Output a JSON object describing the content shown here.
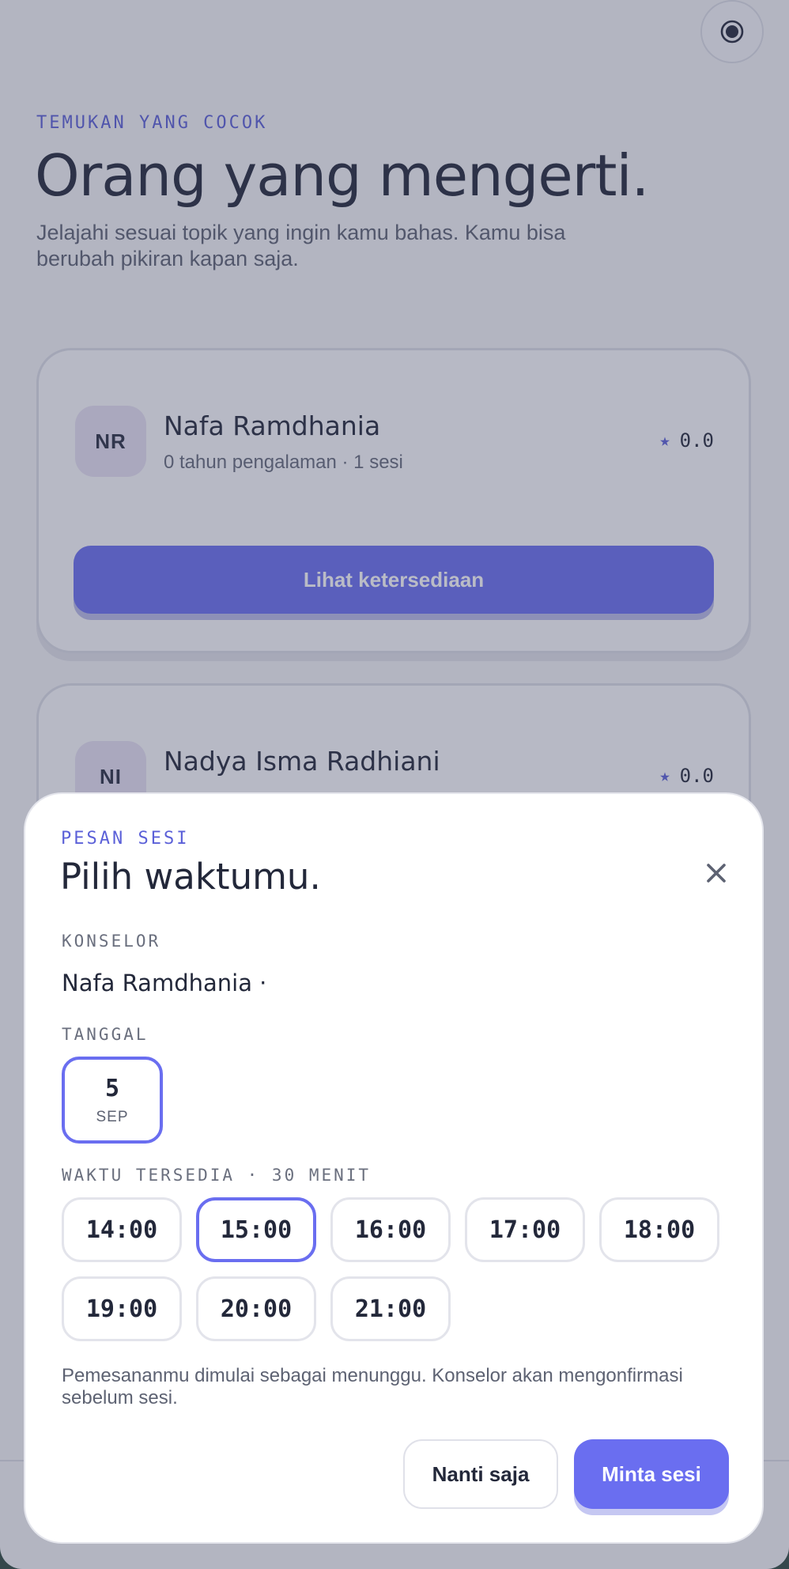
{
  "page": {
    "eyebrow": "TEMUKAN YANG COCOK",
    "title": "Orang yang mengerti.",
    "subtitle": "Jelajahi sesuai topik yang ingin kamu bahas. Kamu bisa berubah pikiran kapan saja."
  },
  "theme_toggle": {
    "icon": "radio-dot-icon"
  },
  "counselors": [
    {
      "initials": "NR",
      "name": "Nafa Ramdhania",
      "meta": "0 tahun pengalaman · 1 sesi",
      "rating_star": "★",
      "rating": "0.0",
      "action_label": "Lihat ketersediaan"
    },
    {
      "initials": "NI",
      "name": "Nadya Isma Radhiani",
      "rating_star": "★",
      "rating": "0.0"
    }
  ],
  "booking": {
    "eyebrow": "PESAN SESI",
    "title": "Pilih waktumu.",
    "close_icon": "close-icon",
    "counselor_label": "KONSELOR",
    "counselor_value": "Nafa Ramdhania ·",
    "date_label": "TANGGAL",
    "dates": [
      {
        "day": "5",
        "month": "SEP",
        "selected": true
      }
    ],
    "time_label": "WAKTU TERSEDIA · 30 MENIT",
    "slots": [
      "14:00",
      "15:00",
      "16:00",
      "17:00",
      "18:00",
      "19:00",
      "20:00",
      "21:00"
    ],
    "selected_slot": "15:00",
    "note": "Pemesananmu dimulai sebagai menunggu. Konselor akan mengonfirmasi sebelum sesi.",
    "later_label": "Nanti saja",
    "request_label": "Minta sesi"
  },
  "colors": {
    "accent": "#6a6ef0",
    "eyebrow": "#5b60d8",
    "text": "#23283a",
    "muted": "#5d6272"
  }
}
